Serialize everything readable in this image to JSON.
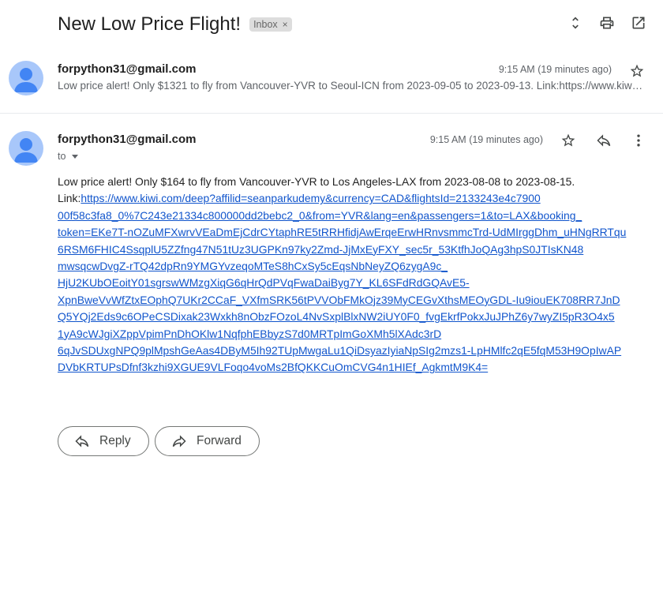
{
  "subject": "New Low Price Flight!",
  "label": "Inbox",
  "label_remove": "×",
  "top_actions": [
    "expand-collapse-icon",
    "print-icon",
    "open-in-new-window-icon"
  ],
  "message1": {
    "sender": "forpython31@gmail.com",
    "time": "9:15 AM (19 minutes ago)",
    "snippet": "Low price alert! Only $1321 to fly from Vancouver-YVR to Seoul-ICN from 2023-09-05 to 2023-09-13. Link:https://www.kiwi.com/deep?affilid=seanparkudemy"
  },
  "message2": {
    "sender": "forpython31@gmail.com",
    "time": "9:15 AM (19 minutes ago)",
    "to": "to",
    "body_text": "Low price alert! Only $164 to fly from Vancouver-YVR to Los Angeles-LAX from 2023-08-08 to 2023-08-15.",
    "link_prefix": "Link:",
    "link_lines": [
      "https://www.kiwi.com/deep?affilid=seanparkudemy&currency=CAD&flightsId=2133243e4c7900",
      "00f58c3fa8_0%7C243e21334c800000dd2bebc2_0&from=YVR&lang=en&passengers=1&to=LAX&booking_",
      "token=EKe7T-nOZuMFXwrvVEaDmEjCdrCYtaphRE5tRRHfidjAwErqeErwHRnvsmmcTrd-UdMIrggDhm_uHNgRRTqu",
      "6RSM6FHIC4SsqplU5ZZfng47N51tUz3UGPKn97ky2Zmd-JjMxEyFXY_sec5r_53KtfhJoQAg3hpS0JTIsKN48",
      "mwsqcwDvgZ-rTQ42dpRn9YMGYvzeqoMTeS8hCxSy5cEqsNbNeyZQ6zygA9c_",
      "HjU2KUbOEoitY01sgrswWMzgXiqG6qHrQdPVqFwaDaiByg7Y_KL6SFdRdGQAvE5-",
      "XpnBweVvWfZtxEOphQ7UKr2CCaF_VXfmSRK56tPVVObFMkOjz39MyCEGvXthsMEOyGDL-Iu9iouEK708RR7JnD",
      "Q5YQj2Eds9c6OPeCSDixak23Wxkh8nObzFOzoL4NvSxplBlxNW2iUY0F0_fvgEkrfPokxJuJPhZ6y7wyZI5pR3O4x5",
      "1yA9cWJgiXZppVpimPnDhOKlw1NqfphEBbyzS7d0MRTpImGoXMh5lXAdc3rD",
      "6qJvSDUxgNPQ9plMpshGeAas4DByM5Ih92TUpMwgaLu1QiDsyazIyiaNpSIg2mzs1-LpHMlfc2qE5fqM53H9OpIwAP",
      "DVbKRTUPsDfnf3kzhi9XGUE9VLFoqo4voMs2BfQKKCuOmCVG4n1HIEf_AgkmtM9K4="
    ]
  },
  "actions": {
    "reply": "Reply",
    "forward": "Forward"
  }
}
